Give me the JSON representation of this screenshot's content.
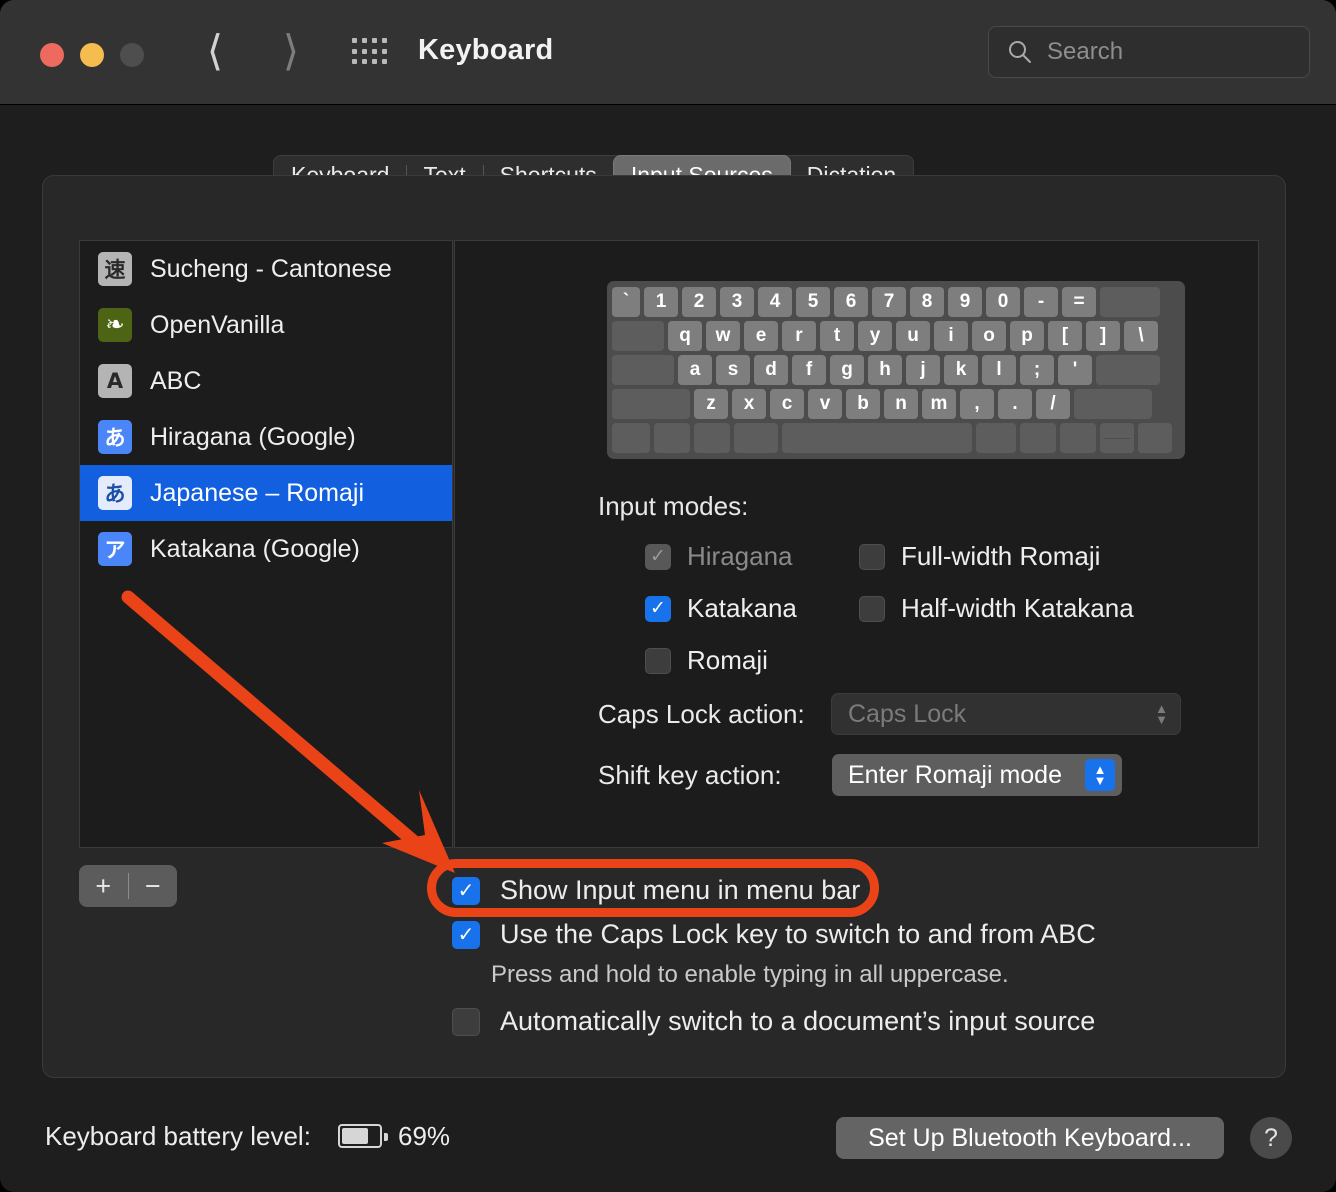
{
  "window": {
    "title": "Keyboard",
    "traffic_lights": [
      "close",
      "minimize",
      "zoom"
    ],
    "nav_back_icon": "chevron-left-icon",
    "nav_forward_icon": "chevron-right-icon",
    "grid_icon": "show-all-grid-icon",
    "search": {
      "placeholder": "Search",
      "value": "",
      "icon": "search-icon"
    }
  },
  "tabs": [
    {
      "label": "Keyboard",
      "active": false
    },
    {
      "label": "Text",
      "active": false
    },
    {
      "label": "Shortcuts",
      "active": false
    },
    {
      "label": "Input Sources",
      "active": true
    },
    {
      "label": "Dictation",
      "active": false
    }
  ],
  "sources": {
    "items": [
      {
        "label": "Sucheng - Cantonese",
        "glyph": "速",
        "bg": "#b4b4b4",
        "fg": "#2a2a2a",
        "selected": false
      },
      {
        "label": "OpenVanilla",
        "glyph": "❧",
        "bg": "#4c6414",
        "fg": "#ffffff",
        "selected": false
      },
      {
        "label": "ABC",
        "glyph": "A",
        "bg": "#b4b4b4",
        "fg": "#2a2a2a",
        "selected": false
      },
      {
        "label": "Hiragana (Google)",
        "glyph": "あ",
        "bg": "#4a86f7",
        "fg": "#ffffff",
        "selected": false
      },
      {
        "label": "Japanese – Romaji",
        "glyph": "あ",
        "bg": "#e4ecfb",
        "fg": "#1b4fa8",
        "selected": true
      },
      {
        "label": "Katakana (Google)",
        "glyph": "ア",
        "bg": "#4a86f7",
        "fg": "#ffffff",
        "selected": false
      }
    ],
    "add_label": "+",
    "remove_label": "−"
  },
  "keyboard_preview": {
    "rows": [
      [
        "`",
        "1",
        "2",
        "3",
        "4",
        "5",
        "6",
        "7",
        "8",
        "9",
        "0",
        "-",
        "="
      ],
      [
        "q",
        "w",
        "e",
        "r",
        "t",
        "y",
        "u",
        "i",
        "o",
        "p",
        "[",
        "]",
        "\\"
      ],
      [
        "a",
        "s",
        "d",
        "f",
        "g",
        "h",
        "j",
        "k",
        "l",
        ";",
        "'"
      ],
      [
        "z",
        "x",
        "c",
        "v",
        "b",
        "n",
        "m",
        ",",
        ".",
        "/"
      ]
    ]
  },
  "input_modes": {
    "label": "Input modes:",
    "left": [
      {
        "label": "Hiragana",
        "checked": true,
        "disabled": true
      },
      {
        "label": "Katakana",
        "checked": true,
        "disabled": false
      },
      {
        "label": "Romaji",
        "checked": false,
        "disabled": false
      }
    ],
    "right": [
      {
        "label": "Full-width Romaji",
        "checked": false,
        "disabled": false
      },
      {
        "label": "Half-width Katakana",
        "checked": false,
        "disabled": false
      }
    ]
  },
  "popups": {
    "caps_lock": {
      "label": "Caps Lock action:",
      "value": "Caps Lock",
      "disabled": true
    },
    "shift_key": {
      "label": "Shift key action:",
      "value": "Enter Romaji mode",
      "disabled": false
    }
  },
  "options": [
    {
      "label": "Show Input menu in menu bar",
      "checked": true,
      "highlighted": true
    },
    {
      "label": "Use the Caps Lock key to switch to and from ABC",
      "checked": true,
      "highlighted": false
    },
    {
      "label": "Automatically switch to a document’s input source",
      "checked": false,
      "highlighted": false
    }
  ],
  "options_note": "Press and hold to enable typing in all uppercase.",
  "footer": {
    "battery_label": "Keyboard battery level:",
    "battery_percent": "69%",
    "battery_fill": 69,
    "bluetooth_button": "Set Up Bluetooth Keyboard...",
    "help_button": "?"
  },
  "annotation": {
    "color": "#ea4318",
    "target": "Show Input menu in menu bar"
  }
}
